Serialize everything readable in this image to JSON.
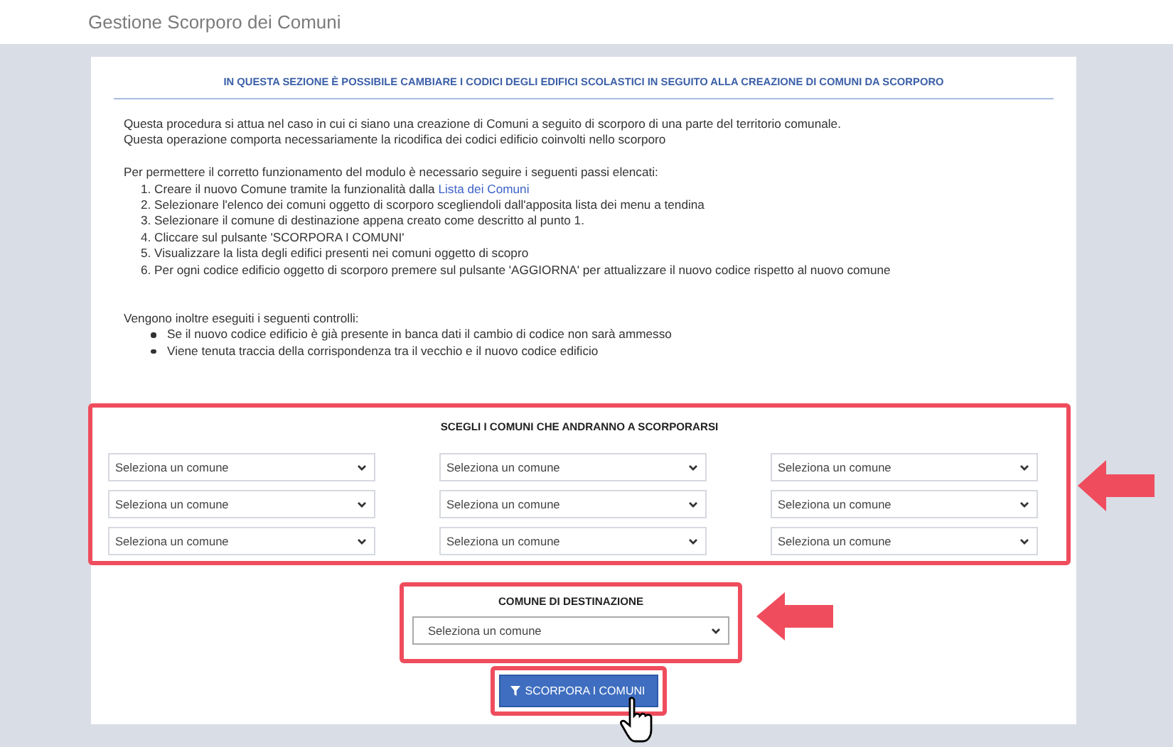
{
  "page_title": "Gestione Scorporo dei Comuni",
  "section_heading": "IN QUESTA SEZIONE È POSSIBILE CAMBIARE I CODICI DEGLI EDIFICI SCOLASTICI IN SEGUITO ALLA CREAZIONE DI COMUNI DA SCORPORO",
  "intro": [
    "Questa procedura si attua nel caso in cui ci siano una creazione di Comuni a seguito di scorporo di una parte del territorio comunale.",
    "Questa operazione comporta necessariamente la ricodifica dei codici edificio coinvolti nello scorporo"
  ],
  "steps_intro": "Per permettere il corretto funzionamento del modulo è necessario seguire i seguenti passi elencati:",
  "steps": [
    {
      "text": "1. Creare il nuovo Comune tramite la funzionalità dalla ",
      "link": "Lista dei Comuni"
    },
    {
      "text": "2. Selezionare l'elenco dei comuni oggetto di scorporo scegliendoli dall'apposita lista dei menu a tendina"
    },
    {
      "text": "3. Selezionare il comune di destinazione appena creato come descritto al punto 1."
    },
    {
      "text": "4. Cliccare sul pulsante 'SCORPORA I COMUNI'"
    },
    {
      "text": "5. Visualizzare la lista degli edifici presenti nei comuni oggetto di scopro"
    },
    {
      "text": "6. Per ogni codice edificio oggetto di scorporo premere sul pulsante 'AGGIORNA' per attualizzare il nuovo codice rispetto al nuovo comune"
    }
  ],
  "checks_intro": "Vengono inoltre eseguiti i seguenti controlli:",
  "checks": [
    "Se il nuovo codice edificio è già presente in banca dati il cambio di codice non sarà ammesso",
    "Viene tenuta traccia della corrispondenza tra il vecchio e il nuovo codice edificio"
  ],
  "source_section": {
    "heading": "SCEGLI I COMUNI CHE ANDRANNO A SCORPORARSI",
    "selects": [
      {
        "placeholder": "Seleziona un comune"
      },
      {
        "placeholder": "Seleziona un comune"
      },
      {
        "placeholder": "Seleziona un comune"
      },
      {
        "placeholder": "Seleziona un comune"
      },
      {
        "placeholder": "Seleziona un comune"
      },
      {
        "placeholder": "Seleziona un comune"
      },
      {
        "placeholder": "Seleziona un comune"
      },
      {
        "placeholder": "Seleziona un comune"
      },
      {
        "placeholder": "Seleziona un comune"
      }
    ]
  },
  "destination": {
    "heading": "COMUNE DI DESTINAZIONE",
    "placeholder": "Seleziona un comune"
  },
  "submit_button": "SCORPORA I COMUNI"
}
